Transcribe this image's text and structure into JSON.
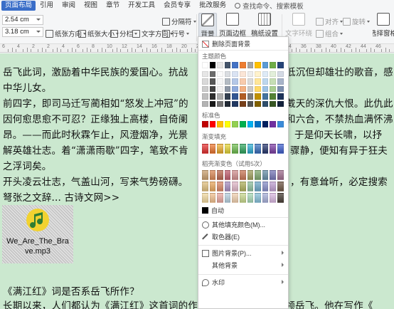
{
  "tabs": {
    "active": "页面布局",
    "items": [
      "引用",
      "审阅",
      "视图",
      "章节",
      "开发工具",
      "会员专享",
      "批改服务"
    ],
    "search": "查找命令、搜索模板"
  },
  "ribbon": {
    "margin_top": "2.54 cm",
    "margin_bottom": "3.18 cm",
    "paper_orientation": "纸张方向",
    "paper_size": "纸张大小",
    "columns": "分栏",
    "text_direction": "文字方向",
    "separator": "分隔符",
    "line_number": "行号",
    "background": "背景",
    "page_border": "页面边框",
    "manuscript": "稿纸设置",
    "text_wrap": "文字环绕",
    "align": "对齐",
    "rotate": "旋转",
    "group": "组合",
    "select_pane": "选择窗格"
  },
  "ruler": {
    "numbers": [
      "6",
      "4",
      "2",
      "2",
      "4",
      "6",
      "8",
      "10",
      "12",
      "14",
      "16",
      "18",
      "20",
      "22",
      "24",
      "26",
      "28",
      "30",
      "32",
      "34",
      "36",
      "38",
      "40",
      "42",
      "44",
      "46"
    ]
  },
  "document": {
    "lines": [
      "岳飞此词，激励着中华民族的爱国心。抗战",
      "中华儿女。",
      "前四字，即司马迁写蔺相如“怒发上冲冠”的",
      "因何愈思愈不可忍？正缘独上高楼，自倚阑",
      "昂。——而此时秋霖乍止，风澄烟净，光景",
      "解英雄壮志。着“潇潇雨歇”四字，笔致不肯",
      "之浮词矣。",
      "开头凌云壮志，气盖山河，写来气势磅礴。",
      "弩张之文辞... 古诗文网>>"
    ],
    "right_fragments": [
      "低沉但却雄壮的歌音，感",
      "戴天的深仇大恨。此仇此",
      "和六合，不禁热血满怀沸",
      "于是仰天长啸，以抒",
      "骤静，便知有异于狂夫",
      "，有意耸听，必定搜索"
    ],
    "attachment_name_1": "We_Are_The_Bra",
    "attachment_name_2": "ve.mp3",
    "after_lines": [
      "《满江红》词是否系岳飞所作？",
      "长期以来，人们都认为《满江红》这首词的作者是宋代著名爱国将领岳飞。他在写作《"
    ]
  },
  "panel": {
    "delete_background": "删除页面背景",
    "theme_colors_label": "主题颜色",
    "standard_colors_label": "标准色",
    "gradient_fill_label": "渐变填充",
    "rice_gradient_label": "稻壳渐变色（试用5次）",
    "auto_label": "自动",
    "other_fill_color": "其他填充颜色(M)...",
    "color_picker": "取色器(E)",
    "picture_background": "图片背景(P)...",
    "other_background": "其他背景",
    "watermark": "水印"
  },
  "colors": {
    "document_background": "#cbe8cf",
    "active_tab": "#3a6ec8",
    "theme_top_row": [
      "#ffffff",
      "#000000",
      "#e7e6e6",
      "#44546a",
      "#4472c4",
      "#ed7d31",
      "#a5a5a5",
      "#ffc000",
      "#5b9bd5",
      "#70ad47",
      "#264478"
    ],
    "standard_colors": [
      "#c00000",
      "#ff0000",
      "#ffc000",
      "#ffff00",
      "#92d050",
      "#00b050",
      "#00b0f0",
      "#0070c0",
      "#002060",
      "#7030a0",
      "#3b8bd8"
    ],
    "gradient_colors": [
      "#e83030",
      "#f07830",
      "#f0b030",
      "#e8d838",
      "#70c050",
      "#30a860",
      "#30b0d8",
      "#3870c0",
      "#283870",
      "#8040a8",
      "#4060d0"
    ]
  }
}
